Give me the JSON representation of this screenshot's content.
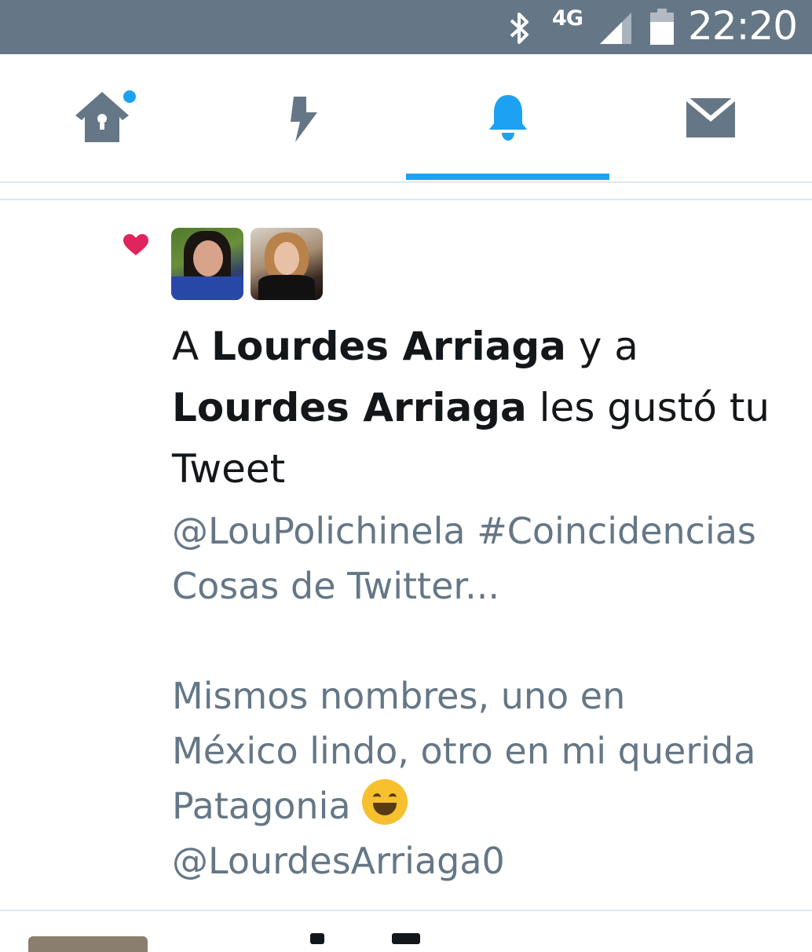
{
  "status_bar": {
    "network": "4G",
    "time": "22:20",
    "icons": [
      "bluetooth-icon",
      "signal-icon",
      "battery-icon"
    ],
    "background_color": "#657786"
  },
  "tabs": [
    {
      "name": "home",
      "icon": "home-icon",
      "has_new_dot": true,
      "active": false
    },
    {
      "name": "moments",
      "icon": "lightning-icon",
      "active": false
    },
    {
      "name": "notifications",
      "icon": "bell-icon",
      "active": true
    },
    {
      "name": "messages",
      "icon": "envelope-icon",
      "active": false
    }
  ],
  "accent_color": "#1da1f2",
  "notification": {
    "type_icon": "heart-icon",
    "type_color": "#e0245e",
    "avatars": [
      "avatar-1",
      "avatar-2"
    ],
    "headline": {
      "prefix": "A ",
      "user1": "Lourdes Arriaga",
      "joiner": " y a ",
      "user2": "Lourdes Arriaga",
      "suffix": " les gustó tu Tweet"
    },
    "tweet": {
      "line1": "@LouPolichinela #Coincidencias",
      "line2": "Cosas de Twitter...",
      "line3": "Mismos nombres, uno en",
      "line4": "México lindo, otro en mi querida",
      "line5": "Patagonia ",
      "emoji": "smiling-face-icon",
      "line6": "@LourdesArriaga0"
    }
  }
}
